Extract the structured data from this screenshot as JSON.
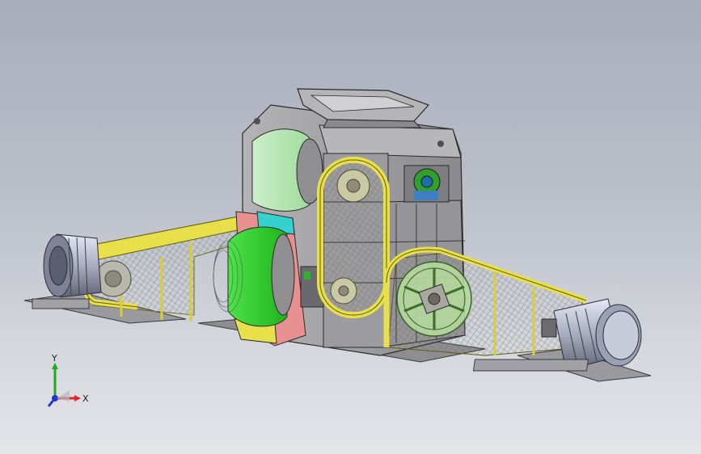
{
  "viewport": {
    "description_free": true
  },
  "triad": {
    "x_label": "X",
    "y_label": "Y",
    "x_color": "#e0242a",
    "y_color": "#22a822",
    "z_color": "#2036d0"
  },
  "colors": {
    "housing": "#a0a0a4",
    "roller_light": "#b9e6b7",
    "roller_bright": "#39d336",
    "belt_guard": "#e8e04a",
    "pink_plate": "#e8908f",
    "cyan_band": "#35d1cf",
    "motor": "#bfc4d6"
  }
}
